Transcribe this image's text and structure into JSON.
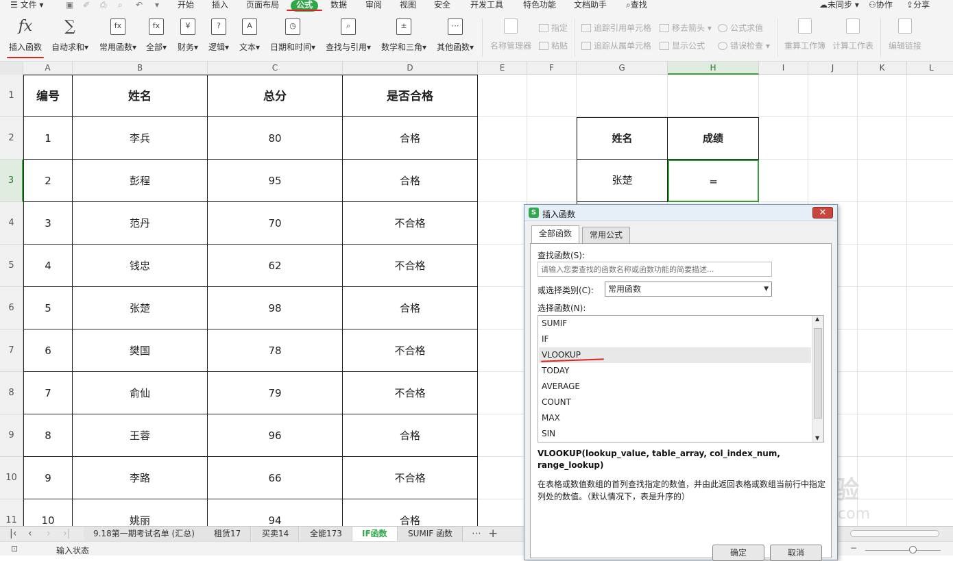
{
  "menubar": {
    "hamburger": "☰",
    "file": "文件",
    "tabs": [
      "开始",
      "插入",
      "页面布局",
      "公式",
      "数据",
      "审阅",
      "视图",
      "安全",
      "开发工具",
      "特色功能",
      "文档助手"
    ],
    "search": "查找",
    "sync": "未同步",
    "collab": "协作",
    "share": "分享"
  },
  "ribbon": {
    "insert_fn": "插入函数",
    "insert_fn_icon": "fx",
    "autosum": "自动求和",
    "autosum_icon": "∑",
    "common": "常用函数",
    "all": "全部",
    "finance": "财务",
    "logic": "逻辑",
    "text": "文本",
    "datetime": "日期和时间",
    "lookup": "查找与引用",
    "math": "数学和三角",
    "other": "其他函数",
    "name_mgr": "名称管理器",
    "define": "指定",
    "paste": "粘贴",
    "trace_prec": "追踪引用单元格",
    "trace_dep": "追踪从属单元格",
    "remove_arrows": "移去箭头",
    "show_formula": "显示公式",
    "eval_formula": "公式求值",
    "error_check": "错误检查",
    "recalc_book": "重算工作簿",
    "calc_sheet": "计算工作表",
    "edit_links": "编辑链接"
  },
  "columns": [
    "A",
    "B",
    "C",
    "D",
    "E",
    "F",
    "G",
    "H",
    "I",
    "J",
    "K",
    "L"
  ],
  "rows": [
    "1",
    "2",
    "3",
    "4",
    "5",
    "6",
    "7",
    "8",
    "9",
    "10",
    "11"
  ],
  "table": {
    "headers": [
      "编号",
      "姓名",
      "总分",
      "是否合格"
    ],
    "data": [
      [
        "1",
        "李兵",
        "80",
        "合格"
      ],
      [
        "2",
        "彭程",
        "95",
        "合格"
      ],
      [
        "3",
        "范丹",
        "70",
        "不合格"
      ],
      [
        "4",
        "钱忠",
        "62",
        "不合格"
      ],
      [
        "5",
        "张楚",
        "98",
        "合格"
      ],
      [
        "6",
        "樊国",
        "78",
        "不合格"
      ],
      [
        "7",
        "俞仙",
        "79",
        "不合格"
      ],
      [
        "8",
        "王蓉",
        "96",
        "合格"
      ],
      [
        "9",
        "李路",
        "66",
        "不合格"
      ],
      [
        "10",
        "姚丽",
        "94",
        "合格"
      ]
    ]
  },
  "lookup_table": {
    "h1": "姓名",
    "h2": "成绩",
    "name": "张楚",
    "value": "="
  },
  "sheet_tabs": [
    "9.18第一期考试名单 (汇总)",
    "租赁17",
    "买卖14",
    "全能173",
    "IF函数",
    "SUMIF 函数"
  ],
  "sheet_more": "⋯",
  "sheet_add": "+",
  "status": "输入状态",
  "dialog": {
    "title": "插入函数",
    "tab_all": "全部函数",
    "tab_common": "常用公式",
    "search_label": "查找函数(S):",
    "search_placeholder": "请输入您要查找的函数名称或函数功能的简要描述...",
    "category_label": "或选择类别(C):",
    "category_value": "常用函数",
    "select_label": "选择函数(N):",
    "functions": [
      "SUMIF",
      "IF",
      "VLOOKUP",
      "TODAY",
      "AVERAGE",
      "COUNT",
      "MAX",
      "SIN"
    ],
    "selected": "VLOOKUP",
    "signature": "VLOOKUP(lookup_value, table_array, col_index_num, range_lookup)",
    "description": "在表格或数值数组的首列查找指定的数值，并由此返回表格或数组当前行中指定列处的数值。（默认情况下，表是升序的）",
    "ok": "确定",
    "cancel": "取消"
  },
  "watermark": "Baidu经验",
  "watermark_url": "jingyan.baidu.com"
}
